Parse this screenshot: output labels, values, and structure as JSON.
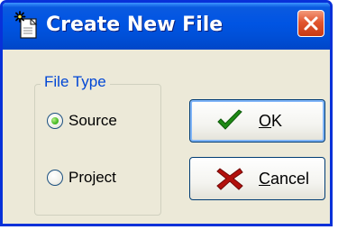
{
  "window": {
    "title": "Create New File",
    "title_icon": "new-file-sparkle-icon",
    "close_icon": "close-x-icon"
  },
  "file_type": {
    "legend": "File Type",
    "options": [
      {
        "label": "Source",
        "selected": true
      },
      {
        "label": "Project",
        "selected": false
      }
    ]
  },
  "buttons": {
    "ok": {
      "mnemonic": "O",
      "rest": "K",
      "icon": "green-checkmark-icon",
      "default": true
    },
    "cancel": {
      "mnemonic": "C",
      "rest": "ancel",
      "icon": "red-x-icon"
    }
  },
  "colors": {
    "titlebar": "#0054e3",
    "close_button": "#e2562f",
    "dialog_face": "#ece9d8",
    "legend_text": "#0046d5",
    "radio_selected": "#21a121",
    "ok_icon": "#1f8a15",
    "cancel_icon": "#b3110d"
  }
}
